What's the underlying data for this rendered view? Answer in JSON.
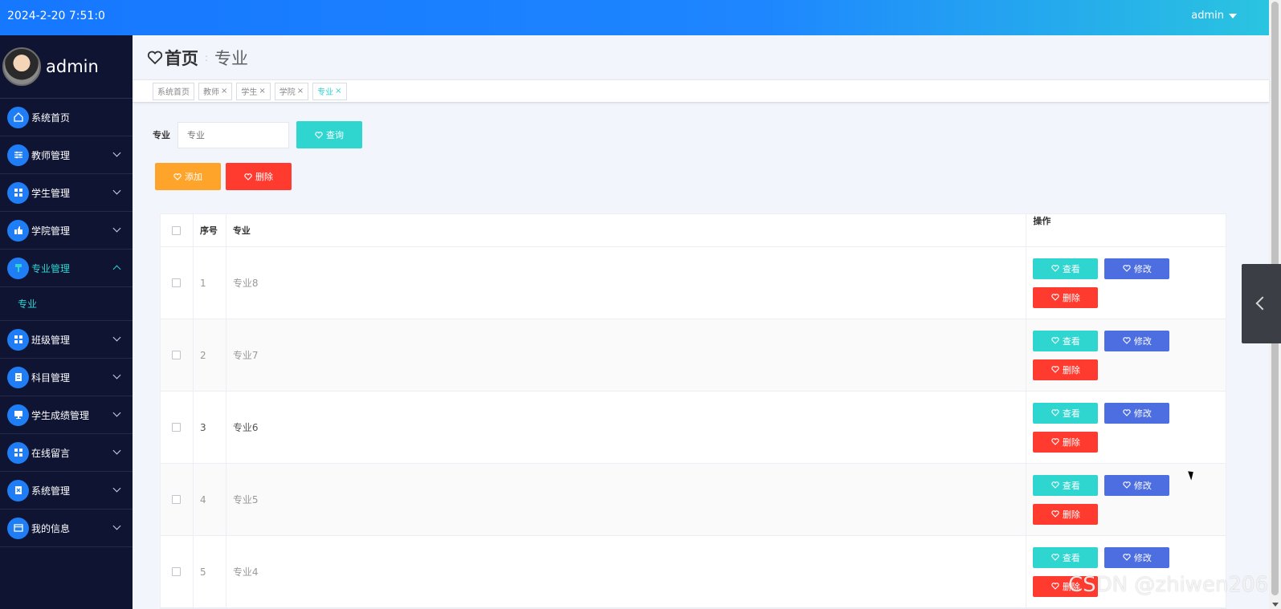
{
  "header": {
    "datetime": "2024-2-20 7:51:0",
    "user": "admin"
  },
  "sidebar": {
    "username": "admin",
    "items": [
      {
        "label": "系统首页",
        "icon": "home-icon",
        "has_chevron": false
      },
      {
        "label": "教师管理",
        "icon": "sliders-icon",
        "has_chevron": true
      },
      {
        "label": "学生管理",
        "icon": "grid-icon",
        "has_chevron": true
      },
      {
        "label": "学院管理",
        "icon": "thumbs-up-icon",
        "has_chevron": true
      },
      {
        "label": "专业管理",
        "icon": "paint-roller-icon",
        "has_chevron": true,
        "expanded": true
      },
      {
        "label": "班级管理",
        "icon": "grid-icon",
        "has_chevron": true
      },
      {
        "label": "科目管理",
        "icon": "clipboard-icon",
        "has_chevron": true
      },
      {
        "label": "学生成绩管理",
        "icon": "monitor-icon",
        "has_chevron": true
      },
      {
        "label": "在线留言",
        "icon": "grid-icon",
        "has_chevron": true
      },
      {
        "label": "系统管理",
        "icon": "clipboard-x-icon",
        "has_chevron": true
      },
      {
        "label": "我的信息",
        "icon": "wallet-icon",
        "has_chevron": true
      }
    ],
    "sub_item": "专业"
  },
  "breadcrumb": {
    "home": "首页",
    "current": "专业"
  },
  "tabs": [
    {
      "label": "系统首页",
      "closable": false
    },
    {
      "label": "教师",
      "closable": true
    },
    {
      "label": "学生",
      "closable": true
    },
    {
      "label": "学院",
      "closable": true
    },
    {
      "label": "专业",
      "closable": true,
      "active": true
    }
  ],
  "search": {
    "label": "专业",
    "placeholder": "专业",
    "button": "查询"
  },
  "actions": {
    "add": "添加",
    "delete": "删除"
  },
  "table": {
    "headers": {
      "no": "序号",
      "name": "专业",
      "op": "操作"
    },
    "rows": [
      {
        "no": "1",
        "name": "专业8"
      },
      {
        "no": "2",
        "name": "专业7"
      },
      {
        "no": "3",
        "name": "专业6"
      },
      {
        "no": "4",
        "name": "专业5"
      },
      {
        "no": "5",
        "name": "专业4"
      }
    ],
    "row_buttons": {
      "view": "查看",
      "edit": "修改",
      "delete": "删除"
    }
  },
  "watermark": "CSDN @zhiwen206",
  "colors": {
    "primary": "#1677ff",
    "sidebar_bg": "#0f1433",
    "accent_cyan": "#2fd6d0",
    "orange": "#ffa42b",
    "red": "#ff3a2f",
    "blue": "#4d6ee0"
  }
}
